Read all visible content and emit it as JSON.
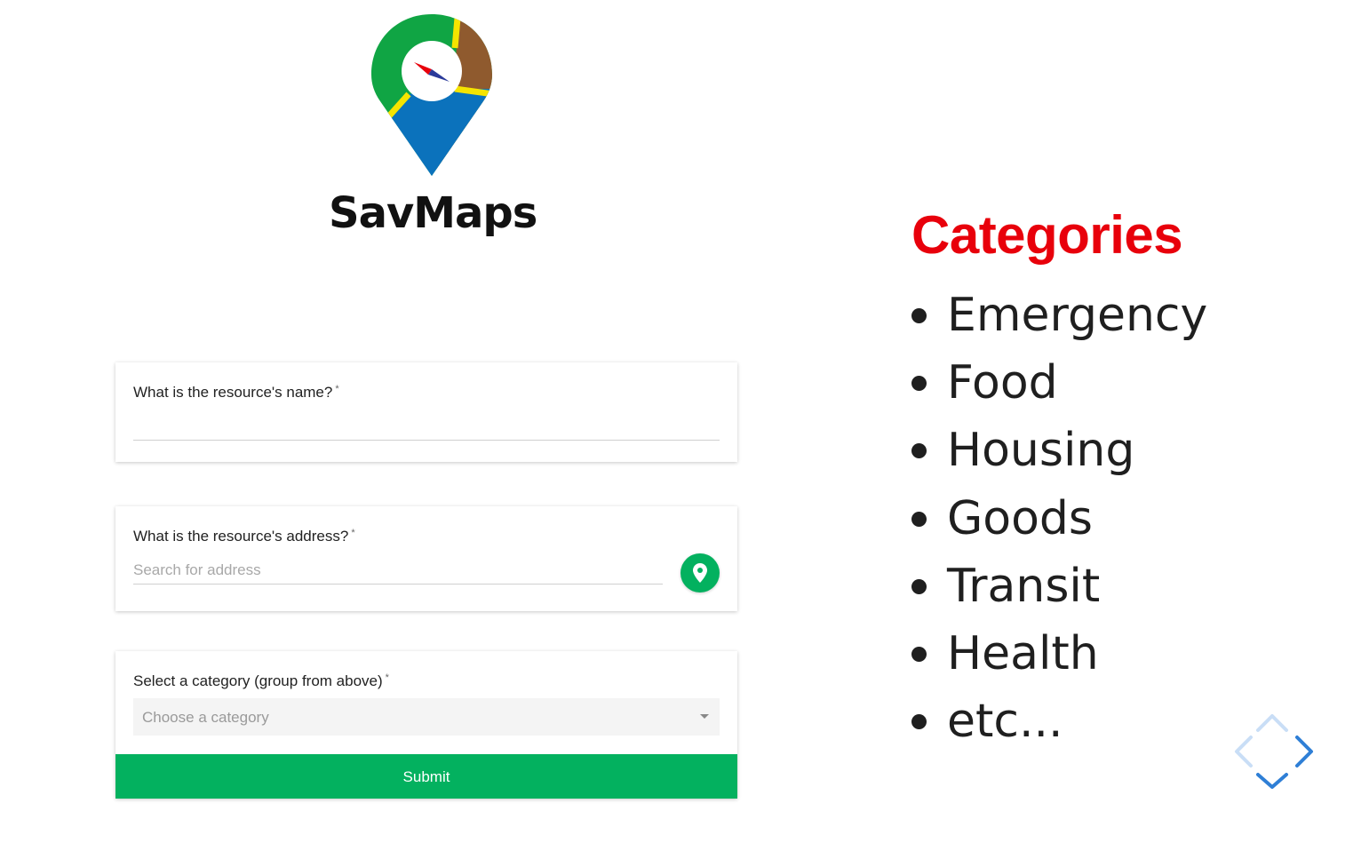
{
  "logo": {
    "name": "SavMaps"
  },
  "form": {
    "name_field": {
      "label": "What is the resource's name?",
      "required_mark": "*",
      "value": ""
    },
    "address_field": {
      "label": "What is the resource's address?",
      "required_mark": "*",
      "placeholder": "Search for address",
      "value": ""
    },
    "category_field": {
      "label": "Select a category (group from above)",
      "required_mark": "*",
      "selected": "Choose a category"
    },
    "submit_label": "Submit"
  },
  "categories": {
    "title": "Categories",
    "items": [
      {
        "label": "Emergency"
      },
      {
        "label": "Food"
      },
      {
        "label": "Housing"
      },
      {
        "label": "Goods"
      },
      {
        "label": "Transit"
      },
      {
        "label": "Health"
      },
      {
        "label": "etc..."
      }
    ]
  },
  "icons": {
    "locate": "map-pin-icon",
    "dropdown": "caret-down-icon",
    "nav": "diamond-navigation-icon"
  },
  "colors": {
    "accent_green": "#03b15f",
    "title_red": "#e8000b",
    "logo_green": "#10a544",
    "logo_brown": "#8f5a2e",
    "logo_blue": "#0b72bc",
    "logo_yellow": "#f5e400"
  }
}
